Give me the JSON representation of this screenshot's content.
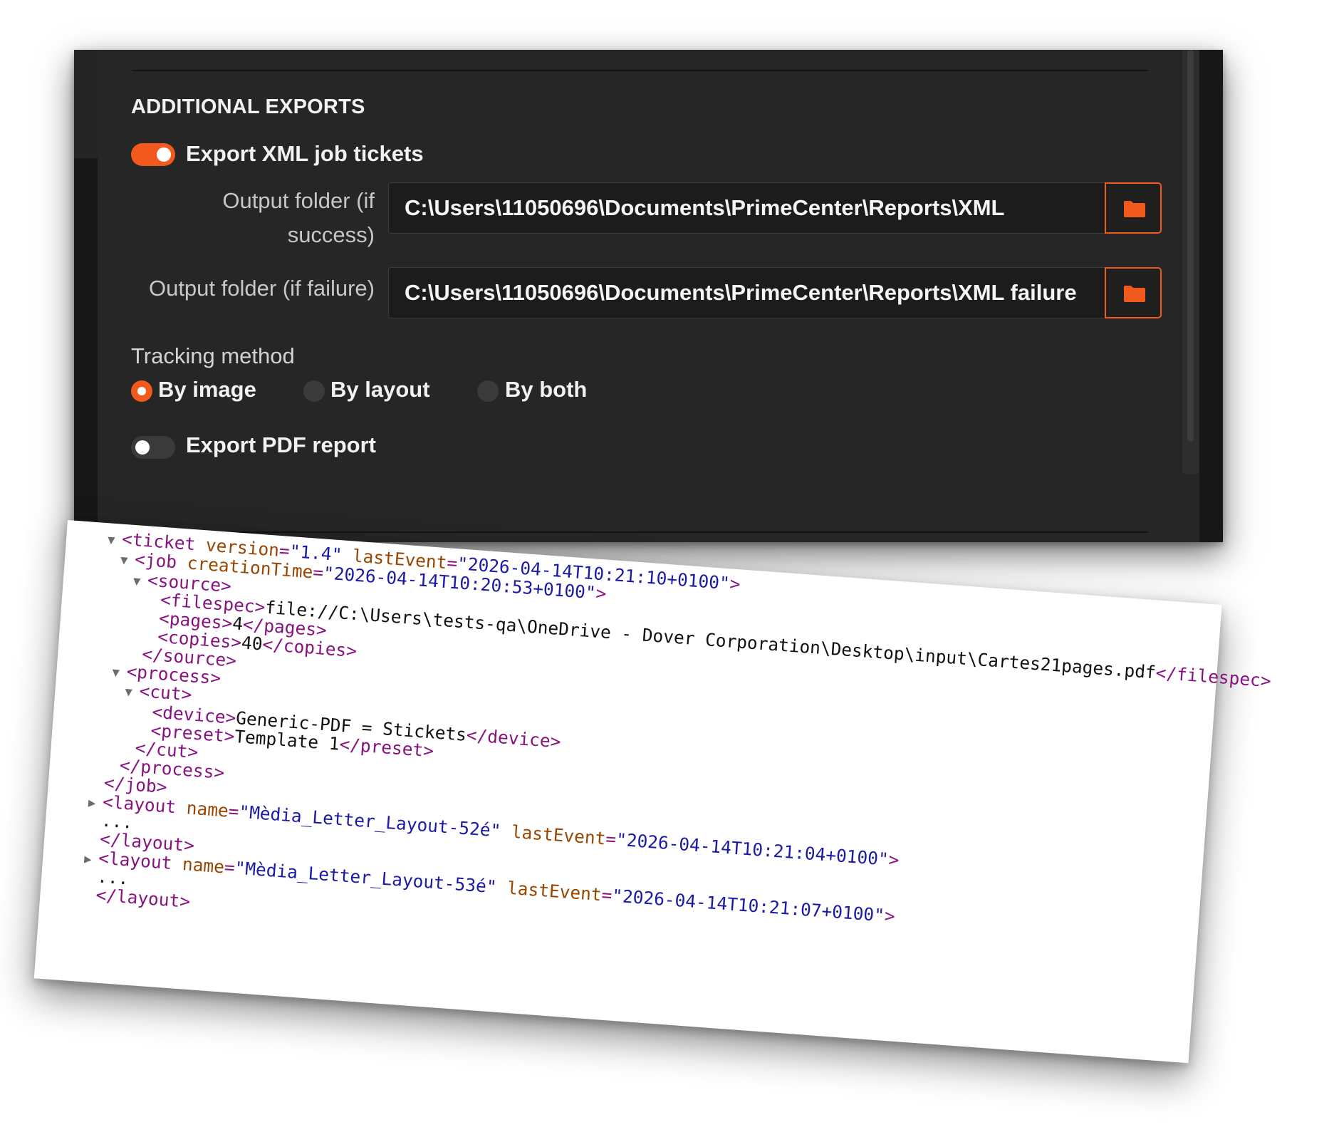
{
  "section": {
    "title": "ADDITIONAL EXPORTS"
  },
  "xml_export": {
    "toggle_label": "Export XML job tickets",
    "toggle_on": true,
    "success_label": "Output folder (if success)",
    "success_label_line1": "Output folder (if",
    "success_label_line2": "success)",
    "success_path": "C:\\Users\\11050696\\Documents\\PrimeCenter\\Reports\\XML",
    "failure_label": "Output folder (if failure)",
    "failure_path": "C:\\Users\\11050696\\Documents\\PrimeCenter\\Reports\\XML failure",
    "browse_icon": "folder-icon"
  },
  "tracking": {
    "label": "Tracking method",
    "options": [
      {
        "label": "By image",
        "selected": true
      },
      {
        "label": "By layout",
        "selected": false
      },
      {
        "label": "By both",
        "selected": false
      }
    ]
  },
  "pdf_report": {
    "toggle_label": "Export PDF report",
    "toggle_on": false
  },
  "colors": {
    "accent": "#f15a1c",
    "panel_bg": "#262626"
  },
  "xml": {
    "ticket_tag": "ticket",
    "ticket_version_attr": "version",
    "ticket_version": "\"1.4\"",
    "ticket_lastEvent_attr": "lastEvent",
    "ticket_lastEvent": "\"2026-04-14T10:21:10+0100\"",
    "job_tag": "job",
    "job_creationTime_attr": "creationTime",
    "job_creationTime": "\"2026-04-14T10:20:53+0100\"",
    "source_tag": "source",
    "filespec_tag": "filespec",
    "filespec_value": "file://C:\\Users\\tests-qa\\OneDrive - Dover Corporation\\Desktop\\input\\Cartes21pages.pdf",
    "pages_tag": "pages",
    "pages_value": "4",
    "copies_tag": "copies",
    "copies_value": "40",
    "process_tag": "process",
    "cut_tag": "cut",
    "device_tag": "device",
    "device_value": "Generic-PDF = Stickets",
    "preset_tag": "preset",
    "preset_value": "Template 1",
    "layout_tag": "layout",
    "name_attr": "name",
    "lastEvent_attr": "lastEvent",
    "layout1_name": "\"Mèdia_Letter_Layout-52é\"",
    "layout1_lastEvent": "\"2026-04-14T10:21:04+0100\"",
    "layout2_name": "\"Mèdia_Letter_Layout-53é\"",
    "layout2_lastEvent": "\"2026-04-14T10:21:07+0100\"",
    "ellipsis": "..."
  }
}
